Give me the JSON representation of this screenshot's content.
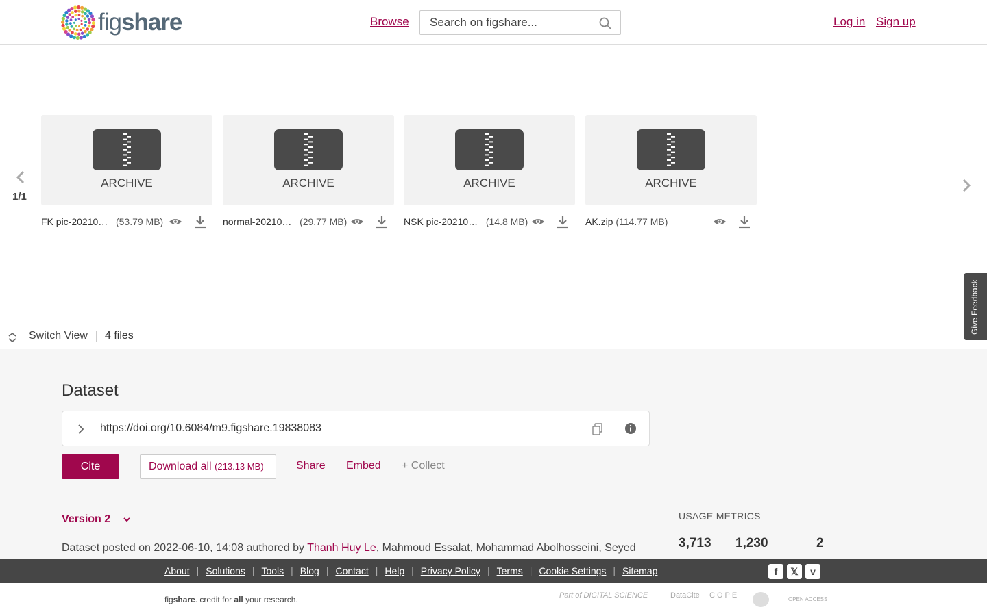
{
  "header": {
    "logo_part1": "fig",
    "logo_part2": "share",
    "browse": "Browse",
    "search_placeholder": "Search on figshare...",
    "login": "Log in",
    "signup": "Sign up"
  },
  "carousel": {
    "page_indicator": "1/1",
    "cards": [
      {
        "type_label": "ARCHIVE",
        "name": "FK pic-20210…",
        "size": "(53.79 MB)"
      },
      {
        "type_label": "ARCHIVE",
        "name": "normal-20210…",
        "size": "(29.77 MB)"
      },
      {
        "type_label": "ARCHIVE",
        "name": "NSK pic-20210…",
        "size": "(14.8 MB)"
      },
      {
        "type_label": "ARCHIVE",
        "name": "AK.zip",
        "size": "(114.77 MB)"
      }
    ]
  },
  "switch_view": {
    "label": "Switch View",
    "files_count": "4 files"
  },
  "feedback": {
    "label": "Give Feedback"
  },
  "dataset": {
    "title": "Dataset",
    "doi": "https://doi.org/10.6084/m9.figshare.19838083",
    "cite": "Cite",
    "download_all": "Download all",
    "download_all_size": "(213.13 MB)",
    "share": "Share",
    "embed": "Embed",
    "collect": "+ Collect",
    "version": "Version 2",
    "posted_type": "Dataset",
    "posted_text": " posted on 2022-06-10, 14:08 authored by ",
    "author_link": "Thanh Huy Le",
    "other_authors": ", Mahmoud Essalat, Mohammad Abolhosseini, Seyed"
  },
  "usage": {
    "title": "USAGE METRICS",
    "values": [
      "3,713",
      "1,230",
      "2"
    ]
  },
  "footer": {
    "links": [
      "About",
      "Solutions",
      "Tools",
      "Blog",
      "Contact",
      "Help",
      "Privacy Policy",
      "Terms",
      "Cookie Settings",
      "Sitemap"
    ],
    "tagline_fig": "fig",
    "tagline_share": "share",
    "tagline_mid": ". credit for ",
    "tagline_all": "all",
    "tagline_end": " your research.",
    "partners": [
      "Part of DIGITAL SCIENCE",
      "DataCite",
      "COPE",
      "OPEN ACCESS"
    ],
    "social": [
      "f",
      "𝕏",
      "v"
    ]
  },
  "colors": {
    "brand": "#a0074d",
    "dark": "#464646"
  }
}
